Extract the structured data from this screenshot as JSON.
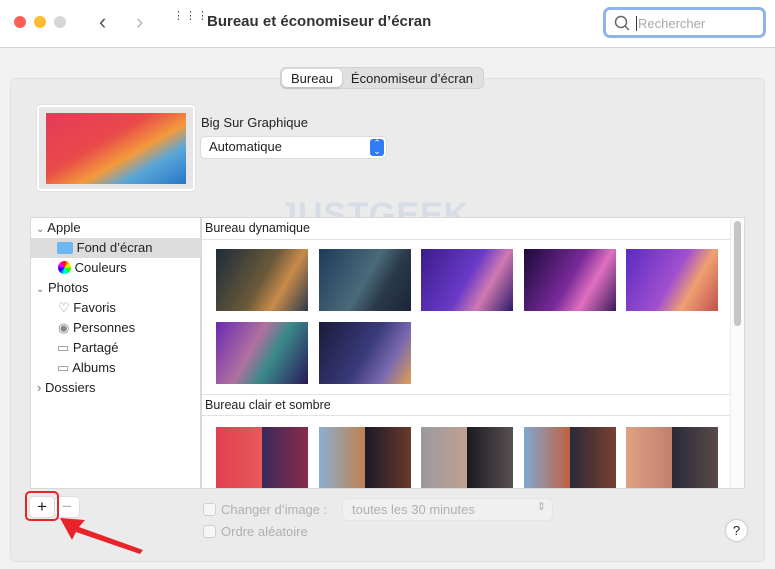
{
  "window": {
    "title": "Bureau et économiseur d’écran",
    "search_placeholder": "Rechercher"
  },
  "tabs": [
    {
      "label": "Bureau",
      "selected": true
    },
    {
      "label": "Économiseur d’écran",
      "selected": false
    }
  ],
  "current": {
    "name": "Big Sur Graphique",
    "mode": "Automatique"
  },
  "sidebar": {
    "items": [
      {
        "label": "Apple",
        "type": "group",
        "expanded": true
      },
      {
        "label": "Fond d’écran",
        "icon": "folder-icon",
        "selected": true
      },
      {
        "label": "Couleurs",
        "icon": "color-wheel-icon"
      },
      {
        "label": "Photos",
        "type": "group",
        "expanded": true
      },
      {
        "label": "Favoris",
        "icon": "heart-icon"
      },
      {
        "label": "Personnes",
        "icon": "person-circle-icon"
      },
      {
        "label": "Partagé",
        "icon": "shared-album-icon"
      },
      {
        "label": "Albums",
        "icon": "album-icon"
      },
      {
        "label": "Dossiers",
        "type": "group",
        "expanded": false
      }
    ]
  },
  "sections": [
    {
      "title": "Bureau dynamique"
    },
    {
      "title": "Bureau clair et sombre"
    }
  ],
  "controls": {
    "add": "+",
    "remove": "−",
    "change_image": "Changer d’image :",
    "interval": "toutes les 30 minutes",
    "random": "Ordre aléatoire",
    "help": "?"
  },
  "watermark": "JUSTGEEK",
  "colors": {
    "accent": "#2f7cf6",
    "highlight": "#e8232a"
  }
}
